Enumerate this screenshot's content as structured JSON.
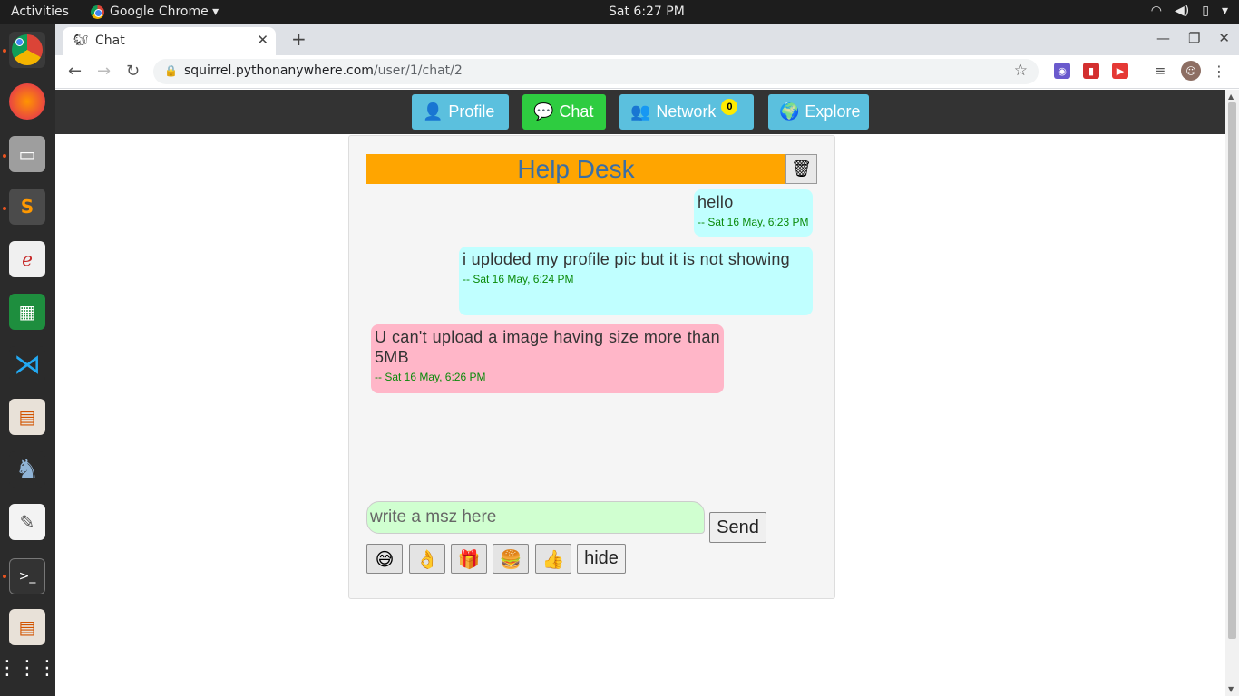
{
  "system": {
    "activities": "Activities",
    "app_menu": "Google Chrome ▾",
    "clock": "Sat  6:27 PM",
    "tray_icons": [
      "wifi-icon",
      "volume-icon",
      "battery-icon",
      "menu-arrow-icon"
    ]
  },
  "dock": {
    "items": [
      "chrome",
      "firefox",
      "files",
      "sublime-text",
      "evince",
      "calc",
      "vscode",
      "impress",
      "pgadmin",
      "gedit",
      "terminal",
      "document-viewer",
      "show-apps"
    ]
  },
  "browser": {
    "tab_title": "Chat",
    "url_host": "squirrel.pythonanywhere.com",
    "url_path": "/user/1/chat/2"
  },
  "nav": {
    "profile": "Profile",
    "chat": "Chat",
    "network": "Network",
    "network_badge": "0",
    "explore": "Explore"
  },
  "chat": {
    "title": "Help Desk",
    "messages": [
      {
        "side": "out",
        "text": "hello",
        "time": "-- Sat 16 May, 6:23 PM"
      },
      {
        "side": "out",
        "text": "i uploded my profile pic but it is not showing",
        "time": "-- Sat 16 May, 6:24 PM"
      },
      {
        "side": "in",
        "text": "U can't upload a image having size more than  5MB",
        "time": "-- Sat 16 May, 6:26 PM"
      }
    ],
    "input_placeholder": "write a msz here",
    "send_label": "Send",
    "emojis": [
      "😅",
      "👌",
      "🎁",
      "🍔",
      "👍"
    ],
    "hide_label": "hide"
  },
  "colors": {
    "header": "#ffa500",
    "profile_btn": "#5bc0de",
    "chat_btn": "#2ecc40",
    "outgoing": "#c0ffff",
    "incoming": "#ffb6c8",
    "input": "#d0ffd0"
  }
}
